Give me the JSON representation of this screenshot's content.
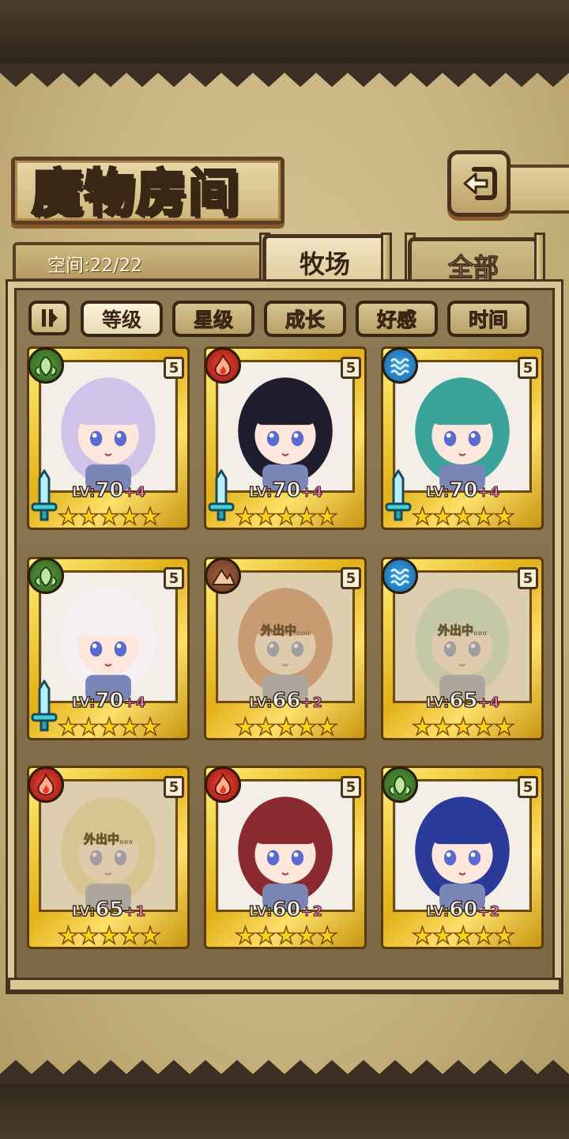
{
  "screen": {
    "title": "魔物房间",
    "back_icon": "return-arrow-icon"
  },
  "info": {
    "space_text": "空间:22/22"
  },
  "tabs": [
    {
      "label": "牧场",
      "active": true
    },
    {
      "label": "全部",
      "active": false
    }
  ],
  "sort": {
    "toggle_icon": "sort-order-icon",
    "options": [
      {
        "label": "等级",
        "active": true
      },
      {
        "label": "星级",
        "active": false
      },
      {
        "label": "成长",
        "active": false
      },
      {
        "label": "好感",
        "active": false
      },
      {
        "label": "时间",
        "active": false
      }
    ]
  },
  "monsters": [
    {
      "element": "wood",
      "rarity": "5",
      "lv_label": "LV:",
      "level": "70",
      "plus": "+4",
      "stars": "★★★★★",
      "equipped": true,
      "away": false,
      "away_text": "",
      "hair": "#cfc3ea"
    },
    {
      "element": "fire",
      "rarity": "5",
      "lv_label": "LV:",
      "level": "70",
      "plus": "+4",
      "stars": "★★★★★",
      "equipped": true,
      "away": false,
      "away_text": "",
      "hair": "#1e1e2e"
    },
    {
      "element": "water",
      "rarity": "5",
      "lv_label": "LV:",
      "level": "70",
      "plus": "+4",
      "stars": "★★★★★",
      "equipped": true,
      "away": false,
      "away_text": "",
      "hair": "#3aa39a"
    },
    {
      "element": "wood",
      "rarity": "5",
      "lv_label": "LV:",
      "level": "70",
      "plus": "+4",
      "stars": "★★★★★",
      "equipped": true,
      "away": false,
      "away_text": "",
      "hair": "#f4f0f4"
    },
    {
      "element": "earth",
      "rarity": "5",
      "lv_label": "LV:",
      "level": "66",
      "plus": "+2",
      "stars": "★★★★★",
      "equipped": false,
      "away": true,
      "away_text": "外出中...",
      "hair": "#c26a4a"
    },
    {
      "element": "water",
      "rarity": "5",
      "lv_label": "LV:",
      "level": "65",
      "plus": "+4",
      "stars": "★★★★★",
      "equipped": false,
      "away": true,
      "away_text": "外出中...",
      "hair": "#b8e0d2"
    },
    {
      "element": "fire",
      "rarity": "5",
      "lv_label": "LV:",
      "level": "65",
      "plus": "+1",
      "stars": "★★★★★",
      "equipped": false,
      "away": true,
      "away_text": "外出中...",
      "hair": "#e8d49a"
    },
    {
      "element": "fire",
      "rarity": "5",
      "lv_label": "LV:",
      "level": "60",
      "plus": "+2",
      "stars": "★★★★★",
      "equipped": false,
      "away": false,
      "away_text": "",
      "hair": "#8a2a2e"
    },
    {
      "element": "wood",
      "rarity": "5",
      "lv_label": "LV:",
      "level": "60",
      "plus": "+2",
      "stars": "★★★★★",
      "equipped": false,
      "away": false,
      "away_text": "",
      "hair": "#2c3a9a"
    }
  ]
}
